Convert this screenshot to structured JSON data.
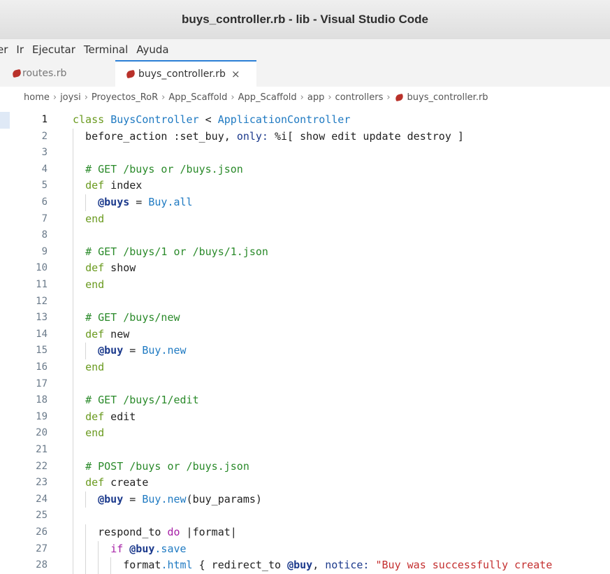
{
  "window": {
    "title": "buys_controller.rb - lib - Visual Studio Code"
  },
  "menu": [
    {
      "label": "er"
    },
    {
      "label": "Ir"
    },
    {
      "label": "Ejecutar"
    },
    {
      "label": "Terminal"
    },
    {
      "label": "Ayuda"
    }
  ],
  "tabs": [
    {
      "label": "routes.rb",
      "active": false
    },
    {
      "label": "buys_controller.rb",
      "active": true,
      "close": "×"
    }
  ],
  "breadcrumb": [
    "home",
    "joysi",
    "Proyectos_RoR",
    "App_Scaffold",
    "App_Scaffold",
    "app",
    "controllers",
    "buys_controller.rb"
  ],
  "colors": {
    "accent": "#2b7fd6",
    "ruby_icon": "#b9312a"
  },
  "icons": {
    "file": "ruby-file-icon",
    "close": "close-icon"
  },
  "editor": {
    "current_line": 1,
    "lines": [
      {
        "n": "1",
        "text": "class BuysController < ApplicationController"
      },
      {
        "n": "2",
        "text": "  before_action :set_buy, only: %i[ show edit update destroy ]"
      },
      {
        "n": "3",
        "text": ""
      },
      {
        "n": "4",
        "text": "  # GET /buys or /buys.json"
      },
      {
        "n": "5",
        "text": "  def index"
      },
      {
        "n": "6",
        "text": "    @buys = Buy.all"
      },
      {
        "n": "7",
        "text": "  end"
      },
      {
        "n": "8",
        "text": ""
      },
      {
        "n": "9",
        "text": "  # GET /buys/1 or /buys/1.json"
      },
      {
        "n": "10",
        "text": "  def show"
      },
      {
        "n": "11",
        "text": "  end"
      },
      {
        "n": "12",
        "text": ""
      },
      {
        "n": "13",
        "text": "  # GET /buys/new"
      },
      {
        "n": "14",
        "text": "  def new"
      },
      {
        "n": "15",
        "text": "    @buy = Buy.new"
      },
      {
        "n": "16",
        "text": "  end"
      },
      {
        "n": "17",
        "text": ""
      },
      {
        "n": "18",
        "text": "  # GET /buys/1/edit"
      },
      {
        "n": "19",
        "text": "  def edit"
      },
      {
        "n": "20",
        "text": "  end"
      },
      {
        "n": "21",
        "text": ""
      },
      {
        "n": "22",
        "text": "  # POST /buys or /buys.json"
      },
      {
        "n": "23",
        "text": "  def create"
      },
      {
        "n": "24",
        "text": "    @buy = Buy.new(buy_params)"
      },
      {
        "n": "25",
        "text": ""
      },
      {
        "n": "26",
        "text": "    respond_to do |format|"
      },
      {
        "n": "27",
        "text": "      if @buy.save"
      },
      {
        "n": "28",
        "text": "        format.html { redirect_to @buy, notice: \"Buy was successfully create"
      }
    ]
  }
}
